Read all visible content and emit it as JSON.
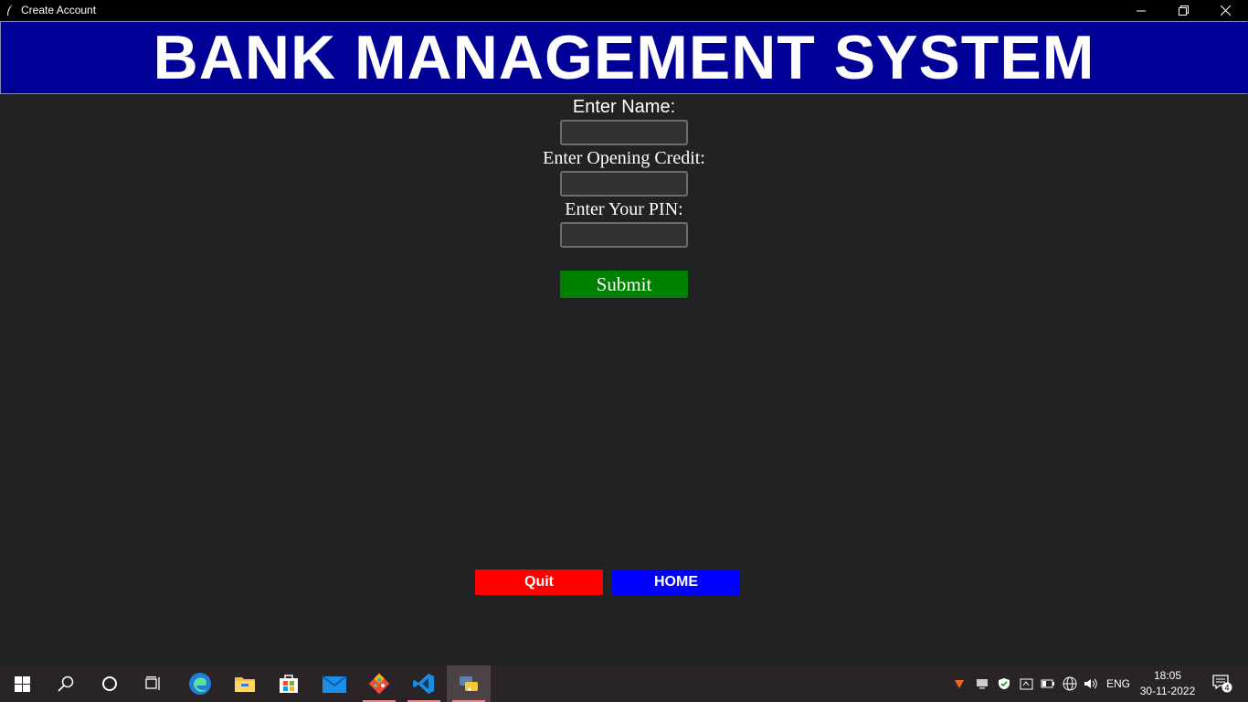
{
  "window": {
    "title": "Create Account",
    "controls": [
      "minimize-icon",
      "restore-icon",
      "close-icon"
    ]
  },
  "header": {
    "title": "BANK MANAGEMENT SYSTEM"
  },
  "form": {
    "name_label": "Enter Name:",
    "name_value": "",
    "credit_label": "Enter Opening Credit:",
    "credit_value": "",
    "pin_label": "Enter Your PIN:",
    "pin_value": "",
    "submit_label": "Submit"
  },
  "footer": {
    "quit_label": "Quit",
    "home_label": "HOME"
  },
  "taskbar": {
    "apps": [
      "windows-start-icon",
      "search-icon",
      "cortana-icon",
      "task-view-icon",
      "edge-icon",
      "file-explorer-icon",
      "store-icon",
      "mail-icon",
      "git-icon",
      "vscode-icon",
      "python-icon"
    ],
    "language": "ENG",
    "time": "18:05",
    "date": "30-11-2022",
    "notification_count": "4"
  },
  "colors": {
    "background": "#212223",
    "header_bg": "#000096",
    "submit_bg": "#008000",
    "quit_bg": "#ff0000",
    "home_bg": "#0000ff"
  }
}
